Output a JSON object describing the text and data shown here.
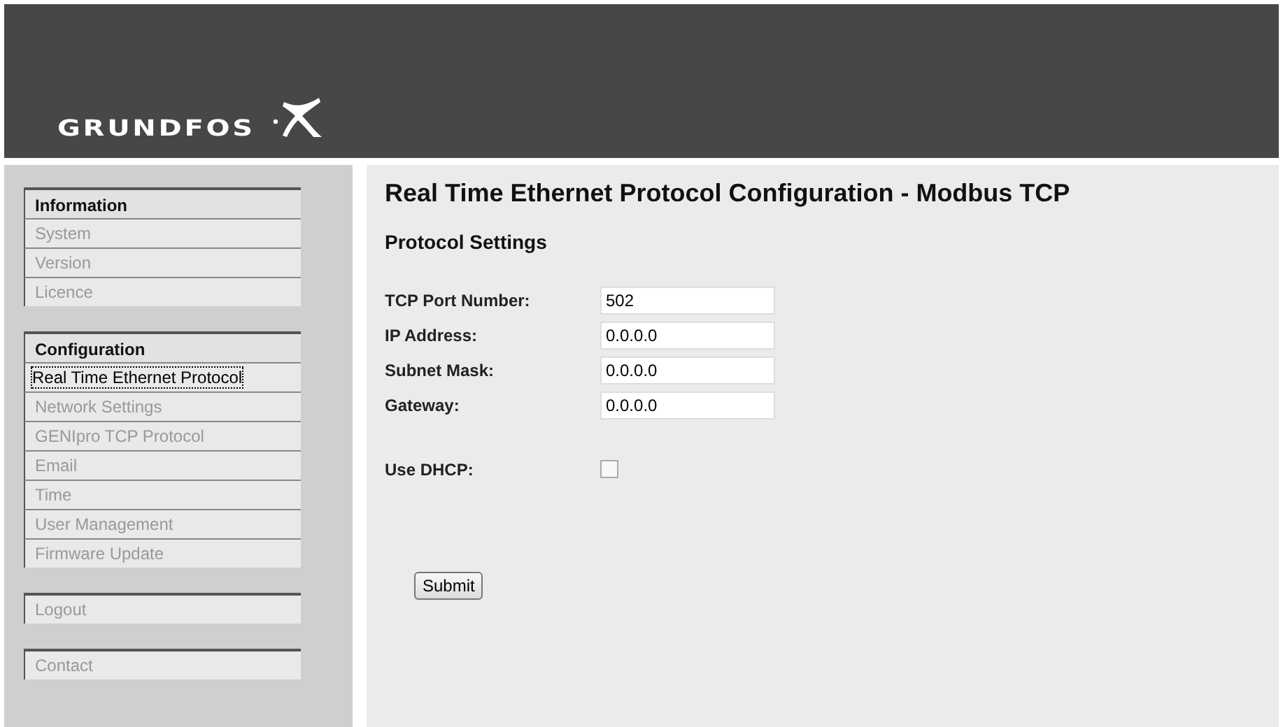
{
  "header": {
    "logo_text": "GRUNDFOS"
  },
  "sidebar": {
    "groups": [
      {
        "title": "Information",
        "items": [
          {
            "label": "System",
            "selected": false
          },
          {
            "label": "Version",
            "selected": false
          },
          {
            "label": "Licence",
            "selected": false
          }
        ]
      },
      {
        "title": "Configuration",
        "items": [
          {
            "label": "Real Time Ethernet Protocol",
            "selected": true
          },
          {
            "label": "Network Settings",
            "selected": false
          },
          {
            "label": "GENIpro TCP Protocol",
            "selected": false
          },
          {
            "label": "Email",
            "selected": false
          },
          {
            "label": "Time",
            "selected": false
          },
          {
            "label": "User Management",
            "selected": false
          },
          {
            "label": "Firmware Update",
            "selected": false
          }
        ]
      },
      {
        "items": [
          {
            "label": "Logout",
            "selected": false
          }
        ]
      },
      {
        "items": [
          {
            "label": "Contact",
            "selected": false
          }
        ]
      }
    ]
  },
  "main": {
    "title": "Real Time Ethernet Protocol Configuration - Modbus TCP",
    "section": "Protocol Settings",
    "fields": [
      {
        "label": "TCP Port Number:",
        "value": "502"
      },
      {
        "label": "IP Address:",
        "value": "0.0.0.0"
      },
      {
        "label": "Subnet Mask:",
        "value": "0.0.0.0"
      },
      {
        "label": "Gateway:",
        "value": "0.0.0.0"
      }
    ],
    "dhcp": {
      "label": "Use DHCP:",
      "checked": false
    },
    "submit": "Submit"
  }
}
